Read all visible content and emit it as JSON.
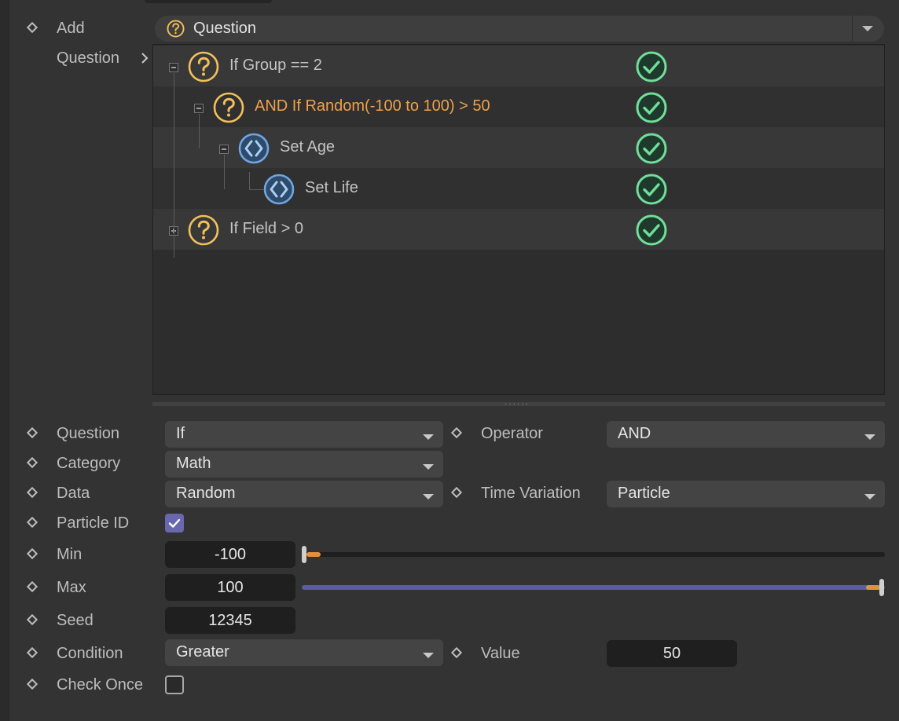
{
  "add": {
    "label": "Add",
    "selected": "Question"
  },
  "tree": {
    "label": "Question",
    "rows": [
      {
        "text": "If Group == 2",
        "type": "question",
        "level": 0,
        "status": "ok"
      },
      {
        "text": "AND If Random(-100 to 100) > 50",
        "type": "question",
        "level": 1,
        "status": "ok",
        "highlight": true
      },
      {
        "text": "Set Age",
        "type": "action",
        "level": 2,
        "status": "ok"
      },
      {
        "text": "Set Life",
        "type": "action",
        "level": 3,
        "status": "ok"
      },
      {
        "text": "If Field > 0",
        "type": "question",
        "level": 0,
        "status": "ok"
      }
    ]
  },
  "props": {
    "question": {
      "label": "Question",
      "value": "If"
    },
    "operator": {
      "label": "Operator",
      "value": "AND"
    },
    "category": {
      "label": "Category",
      "value": "Math"
    },
    "data": {
      "label": "Data",
      "value": "Random"
    },
    "time_variation": {
      "label": "Time Variation",
      "value": "Particle"
    },
    "particle_id": {
      "label": "Particle ID",
      "checked": true
    },
    "min": {
      "label": "Min",
      "value": "-100",
      "slider_fraction": 0.01
    },
    "max": {
      "label": "Max",
      "value": "100",
      "slider_fraction": 0.99
    },
    "seed": {
      "label": "Seed",
      "value": "12345"
    },
    "condition": {
      "label": "Condition",
      "value": "Greater"
    },
    "cond_value": {
      "label": "Value",
      "value": "50"
    },
    "check_once": {
      "label": "Check Once",
      "checked": false
    }
  },
  "colors": {
    "question_icon": "#f2c05a",
    "action_icon": "#6ea7e0",
    "check_ok": "#6fdf9a",
    "highlight_text": "#f0a04b",
    "accent": "#6a67b0"
  },
  "icons": {
    "question": "question-mark-icon",
    "action": "set-chevrons-icon",
    "status": "check-circle-icon",
    "keyframe": "keyframe-diamond-icon"
  }
}
